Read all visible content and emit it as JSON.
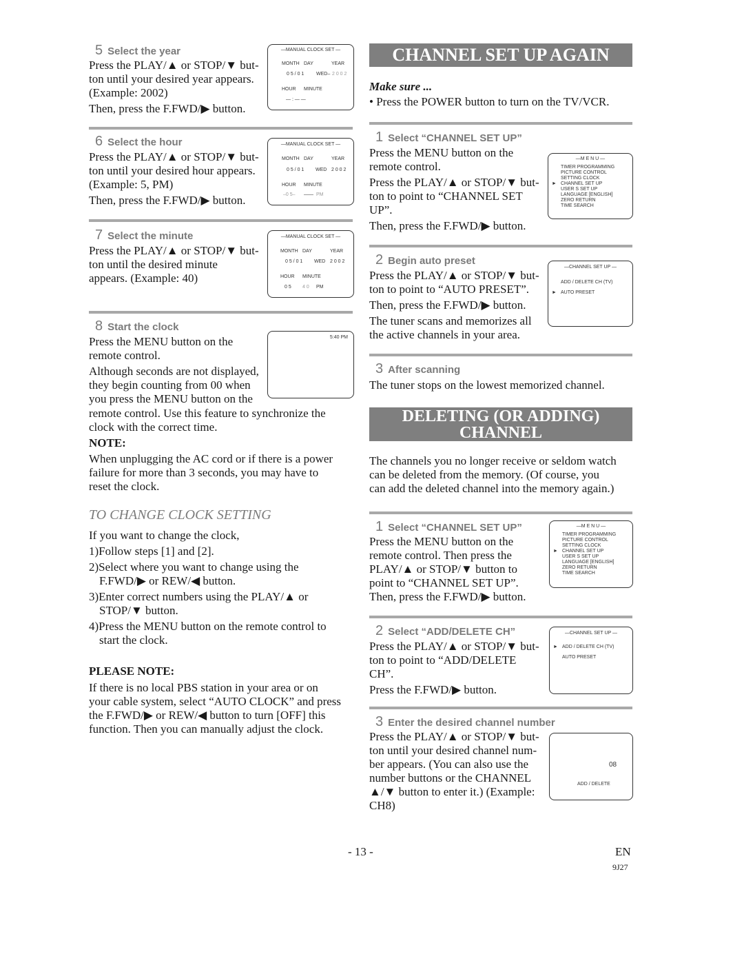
{
  "left": {
    "step5": {
      "num": "5",
      "title": "Select the year",
      "lines": [
        "Press the PLAY/▲ or STOP/▼ but-",
        "ton until your desired year appears.",
        "(Example: 2002)",
        "Then, press the F.FWD/▶ button."
      ],
      "screen": {
        "title": "—MANUAL CLOCK SET —",
        "month_label": "MONTH",
        "day_label": "DAY",
        "year_label": "YEAR",
        "date": "0 5  /  0 1",
        "weekday": "WED–",
        "year": "2 0 0 2",
        "hour_label": "HOUR",
        "minute_label": "MINUTE",
        "time": "— : —  —"
      }
    },
    "step6": {
      "num": "6",
      "title": "Select the hour",
      "lines": [
        "Press the PLAY/▲ or STOP/▼ but-",
        "ton until your desired hour appears.",
        "(Example: 5, PM)",
        "Then, press the F.FWD/▶ button."
      ],
      "screen": {
        "title": "—MANUAL CLOCK SET —",
        "month_label": "MONTH",
        "day_label": "DAY",
        "year_label": "YEAR",
        "date": "0 5  /  0 1",
        "weekday": "WED",
        "year": "2 0 0 2",
        "hour_label": "HOUR",
        "minute_label": "MINUTE",
        "hour": "–0 5–",
        "minute": "——",
        "ampm": "PM"
      }
    },
    "step7": {
      "num": "7",
      "title": "Select the minute",
      "lines": [
        "Press the PLAY/▲ or STOP/▼ but-",
        "ton until the desired minute",
        "appears. (Example: 40)"
      ],
      "screen": {
        "title": "—MANUAL CLOCK SET —",
        "month_label": "MONTH",
        "day_label": "DAY",
        "year_label": "YEAR",
        "date": "0 5  /  0 1",
        "weekday": "WED",
        "year": "2 0 0 2",
        "hour_label": "HOUR",
        "minute_label": "MINUTE",
        "hour": "0 5",
        "minute": "4 0",
        "ampm": "PM"
      }
    },
    "step8": {
      "num": "8",
      "title": "Start the clock",
      "lines_narrow": [
        "Press the MENU button on the",
        "remote control.",
        "Although seconds are not displayed,",
        "they begin counting from 00 when",
        "you press the MENU button on the"
      ],
      "lines_wide": [
        "remote control. Use this feature to synchronize the",
        "clock with the correct time."
      ],
      "screen": {
        "time": "5:40 PM"
      }
    },
    "note": {
      "heading": "NOTE:",
      "lines": [
        "When unplugging the AC cord or if there is a power",
        "failure for more than 3 seconds, you may have to",
        "reset the clock."
      ]
    },
    "change_clock": {
      "heading": "TO CHANGE CLOCK SETTING",
      "intro": "If you want to change the clock,",
      "items": [
        [
          "1)Follow steps [1] and [2]."
        ],
        [
          "2)Select where you want to change using the",
          "F.FWD/▶ or REW/◀ button."
        ],
        [
          "3)Enter correct numbers using the PLAY/▲ or",
          "STOP/▼ button."
        ],
        [
          "4)Press the MENU button on the remote control to",
          "start the clock."
        ]
      ]
    },
    "please_note": {
      "heading": "PLEASE NOTE:",
      "lines": [
        "If there is no local PBS station in your area or on",
        "your cable system, select “AUTO CLOCK” and press",
        "the F.FWD/▶ or REW/◀ button to turn [OFF] this",
        "function. Then you can manually adjust the clock."
      ]
    }
  },
  "right": {
    "section1": {
      "banner": "CHANNEL SET UP AGAIN",
      "make_sure": "Make sure ...",
      "bullet": "• Press the POWER button to turn on the TV/VCR.",
      "step1": {
        "num": "1",
        "title": "Select “CHANNEL SET UP”",
        "lines": [
          "Press the MENU button on the",
          "remote control.",
          "Press the PLAY/▲ or STOP/▼ but-",
          "ton to point to “CHANNEL SET",
          "UP”.",
          "Then, press the F.FWD/▶ button."
        ],
        "screen": {
          "title": "—M E N U —",
          "items": [
            "TIMER PROGRAMMING",
            "PICTURE CONTROL",
            "SETTING CLOCK",
            "CHANNEL SET UP",
            "USER S SET UP",
            "LANGUAGE  [ENGLISH]",
            "ZERO RETURN",
            "TIME SEARCH"
          ],
          "selected_index": 3,
          "arrow": "►"
        }
      },
      "step2": {
        "num": "2",
        "title": "Begin auto preset",
        "lines": [
          "Press the PLAY/▲ or STOP/▼ but-",
          "ton to point to “AUTO PRESET”.",
          "Then, press the F.FWD/▶ button.",
          "The tuner scans and memorizes all",
          "the active channels in your area."
        ],
        "screen": {
          "title": "—CHANNEL SET UP —",
          "items": [
            "ADD / DELETE CH (TV)",
            "AUTO PRESET"
          ],
          "selected_index": 1,
          "arrow": "►"
        }
      },
      "step3": {
        "num": "3",
        "title": "After scanning",
        "lines": [
          "The tuner stops on the lowest memorized channel."
        ]
      }
    },
    "section2": {
      "banner_line1": "DELETING (OR ADDING)",
      "banner_line2": "CHANNEL",
      "intro": [
        "The channels you no longer receive or seldom watch",
        "can be deleted from the memory. (Of course, you",
        "can add the deleted channel into the memory again.)"
      ],
      "step1": {
        "num": "1",
        "title": "Select “CHANNEL SET UP”",
        "lines": [
          "Press the MENU button on the",
          "remote control. Then press the",
          "PLAY/▲ or STOP/▼ button to",
          "point to “CHANNEL SET UP”.",
          "Then, press the F.FWD/▶ button."
        ],
        "screen": {
          "title": "—M E N U —",
          "items": [
            "TIMER PROGRAMMING",
            "PICTURE CONTROL",
            "SETTING CLOCK",
            "CHANNEL SET UP",
            "USER S SET UP",
            "LANGUAGE  [ENGLISH]",
            "ZERO RETURN",
            "TIME SEARCH"
          ],
          "selected_index": 3,
          "arrow": "►"
        }
      },
      "step2": {
        "num": "2",
        "title": "Select “ADD/DELETE CH”",
        "lines": [
          "Press the PLAY/▲ or STOP/▼ but-",
          "ton to point to “ADD/DELETE",
          "CH”.",
          "Press the F.FWD/▶ button."
        ],
        "screen": {
          "title": "—CHANNEL SET UP —",
          "items": [
            "ADD / DELETE CH (TV)",
            "AUTO PRESET"
          ],
          "selected_index": 0,
          "arrow": "►"
        }
      },
      "step3": {
        "num": "3",
        "title": "Enter the desired channel number",
        "lines": [
          "Press the PLAY/▲ or STOP/▼ but-",
          "ton until your desired channel num-",
          "ber appears. (You can also use the",
          "number buttons  or the CHANNEL",
          "▲/▼ button to enter it.) (Example:",
          "CH8)"
        ],
        "screen": {
          "channel": "08",
          "label": "ADD / DELETE"
        }
      }
    }
  },
  "footer": {
    "page": "- 13 -",
    "lang": "EN",
    "code": "9J27"
  }
}
